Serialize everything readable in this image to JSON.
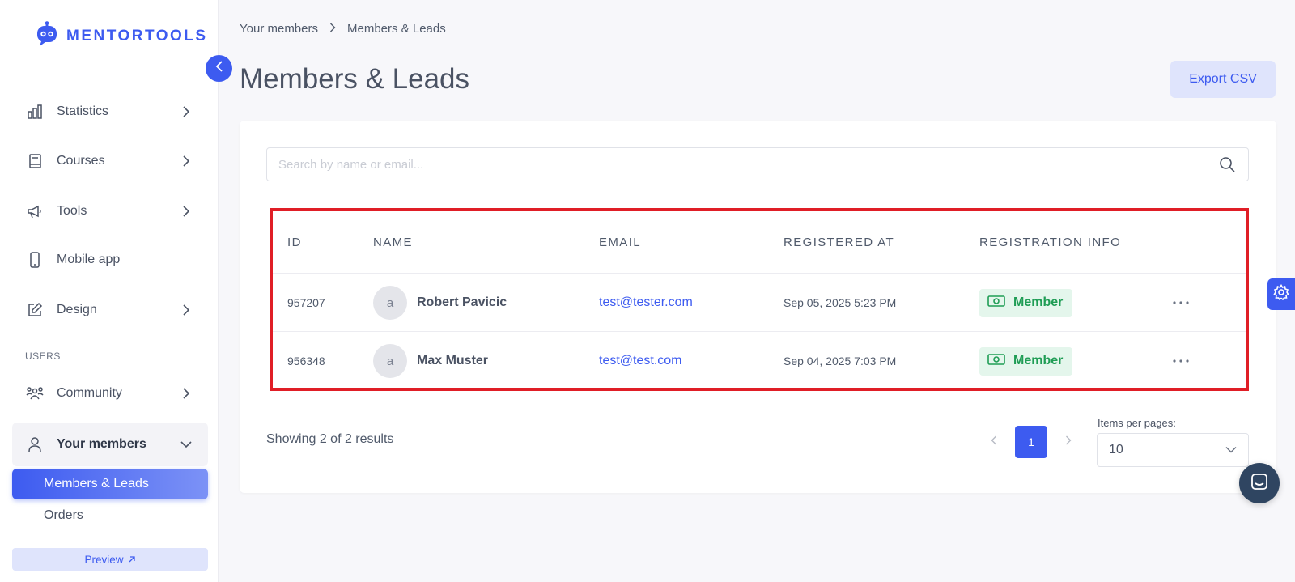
{
  "brand": {
    "name": "MENTORTOOLS"
  },
  "sidebar": {
    "items": [
      {
        "label": "Statistics",
        "icon": "bar-chart-icon"
      },
      {
        "label": "Courses",
        "icon": "book-icon"
      },
      {
        "label": "Tools",
        "icon": "megaphone-icon"
      },
      {
        "label": "Mobile app",
        "icon": "phone-icon"
      },
      {
        "label": "Design",
        "icon": "pencil-icon"
      }
    ],
    "section_label": "USERS",
    "user_items": [
      {
        "label": "Community",
        "icon": "community-icon"
      },
      {
        "label": "Your members",
        "icon": "user-icon"
      }
    ],
    "sub_items": [
      {
        "label": "Members & Leads"
      },
      {
        "label": "Orders"
      }
    ],
    "preview_label": "Preview"
  },
  "breadcrumb": {
    "parent": "Your members",
    "current": "Members & Leads"
  },
  "page": {
    "title": "Members & Leads",
    "export_label": "Export CSV"
  },
  "search": {
    "placeholder": "Search by name or email..."
  },
  "table": {
    "columns": [
      "ID",
      "NAME",
      "EMAIL",
      "REGISTERED AT",
      "REGISTRATION INFO"
    ],
    "rows": [
      {
        "id": "957207",
        "avatar": "a",
        "name": "Robert Pavicic",
        "email": "test@tester.com",
        "registered": "Sep 05, 2025 5:23 PM",
        "info": "Member"
      },
      {
        "id": "956348",
        "avatar": "a",
        "name": "Max Muster",
        "email": "test@test.com",
        "registered": "Sep 04, 2025 7:03 PM",
        "info": "Member"
      }
    ]
  },
  "pagination": {
    "results_text": "Showing 2 of 2 results",
    "current_page": "1",
    "items_per_page_label": "Items per pages:",
    "items_per_page_value": "10"
  },
  "colors": {
    "accent": "#3d5bf0",
    "highlight_border": "#e01e26",
    "badge_bg": "#e4f6ec",
    "badge_text": "#1f9d55"
  }
}
